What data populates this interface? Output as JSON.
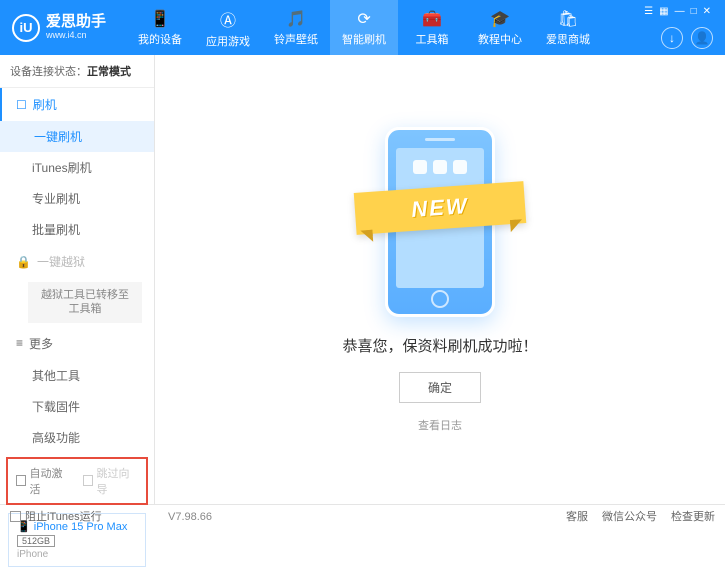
{
  "app": {
    "title": "爱思助手",
    "url": "www.i4.cn",
    "logo_letter": "iU"
  },
  "window_controls": {
    "menu": "☰",
    "grid": "▦",
    "min": "—",
    "max": "□",
    "close": "✕"
  },
  "nav": [
    {
      "icon": "📱",
      "label": "我的设备"
    },
    {
      "icon": "Ⓐ",
      "label": "应用游戏"
    },
    {
      "icon": "🎵",
      "label": "铃声壁纸"
    },
    {
      "icon": "⟳",
      "label": "智能刷机",
      "active": true
    },
    {
      "icon": "🧰",
      "label": "工具箱"
    },
    {
      "icon": "🎓",
      "label": "教程中心"
    },
    {
      "icon": "🛍",
      "label": "爱思商城"
    }
  ],
  "header_icons": {
    "download": "↓",
    "user": "👤"
  },
  "status": {
    "label": "设备连接状态：",
    "value": "正常模式"
  },
  "sidebar": {
    "section1": {
      "icon": "☐",
      "title": "刷机"
    },
    "items1": [
      "一键刷机",
      "iTunes刷机",
      "专业刷机",
      "批量刷机"
    ],
    "section2": {
      "icon": "🔒",
      "title": "一键越狱"
    },
    "moved_note": "越狱工具已转移至工具箱",
    "section3": {
      "icon": "≡",
      "title": "更多"
    },
    "items3": [
      "其他工具",
      "下载固件",
      "高级功能"
    ]
  },
  "checkboxes": {
    "auto_activate": "自动激活",
    "skip_guide": "跳过向导"
  },
  "device": {
    "name": "iPhone 15 Pro Max",
    "storage": "512GB",
    "type": "iPhone"
  },
  "main": {
    "ribbon": "NEW",
    "success": "恭喜您，保资料刷机成功啦！",
    "ok": "确定",
    "log": "查看日志"
  },
  "footer": {
    "block_itunes": "阻止iTunes运行",
    "version": "V7.98.66",
    "links": [
      "客服",
      "微信公众号",
      "检查更新"
    ]
  }
}
